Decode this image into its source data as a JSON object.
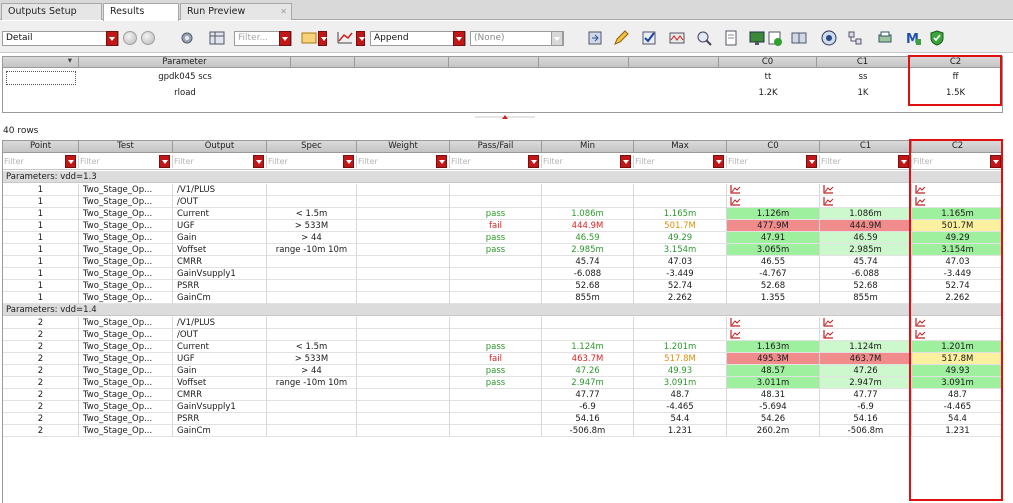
{
  "tabs": [
    {
      "label": "Outputs Setup",
      "active": false
    },
    {
      "label": "Results",
      "active": true
    },
    {
      "label": "Run Preview",
      "active": false,
      "closable": true
    }
  ],
  "toolbar": {
    "view_select": "Detail",
    "filter_placeholder": "Filter...",
    "append_select": "Append",
    "none_select": "(None)"
  },
  "param_table": {
    "headers": [
      "",
      "Parameter",
      "",
      "",
      "",
      "",
      "",
      "C0",
      "C1",
      "C2"
    ],
    "rows": [
      {
        "name": "gpdk045 scs",
        "c0": "tt",
        "c1": "ss",
        "c2": "ff"
      },
      {
        "name": "rload",
        "c0": "1.2K",
        "c1": "1K",
        "c2": "1.5K"
      }
    ]
  },
  "row_count": "40 rows",
  "results": {
    "headers": [
      "Point",
      "Test",
      "Output",
      "Spec",
      "Weight",
      "Pass/Fail",
      "Min",
      "Max",
      "C0",
      "C1",
      "C2"
    ],
    "filter_placeholder": "Filter",
    "groups": [
      {
        "title": "Parameters: vdd=1.3",
        "rows": [
          {
            "point": "1",
            "test": "Two_Stage_Op...",
            "output": "/V1/PLUS",
            "spec": "",
            "pf": "",
            "min": "",
            "max": "",
            "c0": "",
            "c1": "",
            "c2": "",
            "plot": true
          },
          {
            "point": "1",
            "test": "Two_Stage_Op...",
            "output": "/OUT",
            "spec": "",
            "pf": "",
            "min": "",
            "max": "",
            "c0": "",
            "c1": "",
            "c2": "",
            "plot": true
          },
          {
            "point": "1",
            "test": "Two_Stage_Op...",
            "output": "Current",
            "spec": "< 1.5m",
            "pf": "pass",
            "min": "1.086m",
            "max": "1.165m",
            "c0": "1.126m",
            "c1": "1.086m",
            "c2": "1.165m"
          },
          {
            "point": "1",
            "test": "Two_Stage_Op...",
            "output": "UGF",
            "spec": "> 533M",
            "pf": "fail",
            "min": "444.9M",
            "max": "501.7M",
            "c0": "477.9M",
            "c1": "444.9M",
            "c2": "501.7M"
          },
          {
            "point": "1",
            "test": "Two_Stage_Op...",
            "output": "Gain",
            "spec": "> 44",
            "pf": "pass",
            "min": "46.59",
            "max": "49.29",
            "c0": "47.91",
            "c1": "46.59",
            "c2": "49.29"
          },
          {
            "point": "1",
            "test": "Two_Stage_Op...",
            "output": "Voffset",
            "spec": "range -10m 10m",
            "pf": "pass",
            "min": "2.985m",
            "max": "3.154m",
            "c0": "3.065m",
            "c1": "2.985m",
            "c2": "3.154m"
          },
          {
            "point": "1",
            "test": "Two_Stage_Op...",
            "output": "CMRR",
            "spec": "",
            "pf": "",
            "min": "45.74",
            "max": "47.03",
            "c0": "46.55",
            "c1": "45.74",
            "c2": "47.03"
          },
          {
            "point": "1",
            "test": "Two_Stage_Op...",
            "output": "GainVsupply1",
            "spec": "",
            "pf": "",
            "min": "-6.088",
            "max": "-3.449",
            "c0": "-4.767",
            "c1": "-6.088",
            "c2": "-3.449"
          },
          {
            "point": "1",
            "test": "Two_Stage_Op...",
            "output": "PSRR",
            "spec": "",
            "pf": "",
            "min": "52.68",
            "max": "52.74",
            "c0": "52.68",
            "c1": "52.68",
            "c2": "52.74"
          },
          {
            "point": "1",
            "test": "Two_Stage_Op...",
            "output": "GainCm",
            "spec": "",
            "pf": "",
            "min": "855m",
            "max": "2.262",
            "c0": "1.355",
            "c1": "855m",
            "c2": "2.262"
          }
        ]
      },
      {
        "title": "Parameters: vdd=1.4",
        "rows": [
          {
            "point": "2",
            "test": "Two_Stage_Op...",
            "output": "/V1/PLUS",
            "spec": "",
            "pf": "",
            "min": "",
            "max": "",
            "c0": "",
            "c1": "",
            "c2": "",
            "plot": true
          },
          {
            "point": "2",
            "test": "Two_Stage_Op...",
            "output": "/OUT",
            "spec": "",
            "pf": "",
            "min": "",
            "max": "",
            "c0": "",
            "c1": "",
            "c2": "",
            "plot": true
          },
          {
            "point": "2",
            "test": "Two_Stage_Op...",
            "output": "Current",
            "spec": "< 1.5m",
            "pf": "pass",
            "min": "1.124m",
            "max": "1.201m",
            "c0": "1.163m",
            "c1": "1.124m",
            "c2": "1.201m"
          },
          {
            "point": "2",
            "test": "Two_Stage_Op...",
            "output": "UGF",
            "spec": "> 533M",
            "pf": "fail",
            "min": "463.7M",
            "max": "517.8M",
            "c0": "495.3M",
            "c1": "463.7M",
            "c2": "517.8M"
          },
          {
            "point": "2",
            "test": "Two_Stage_Op...",
            "output": "Gain",
            "spec": "> 44",
            "pf": "pass",
            "min": "47.26",
            "max": "49.93",
            "c0": "48.57",
            "c1": "47.26",
            "c2": "49.93"
          },
          {
            "point": "2",
            "test": "Two_Stage_Op...",
            "output": "Voffset",
            "spec": "range -10m 10m",
            "pf": "pass",
            "min": "2.947m",
            "max": "3.091m",
            "c0": "3.011m",
            "c1": "2.947m",
            "c2": "3.091m"
          },
          {
            "point": "2",
            "test": "Two_Stage_Op...",
            "output": "CMRR",
            "spec": "",
            "pf": "",
            "min": "47.77",
            "max": "48.7",
            "c0": "48.31",
            "c1": "47.77",
            "c2": "48.7"
          },
          {
            "point": "2",
            "test": "Two_Stage_Op...",
            "output": "GainVsupply1",
            "spec": "",
            "pf": "",
            "min": "-6.9",
            "max": "-4.465",
            "c0": "-5.694",
            "c1": "-6.9",
            "c2": "-4.465"
          },
          {
            "point": "2",
            "test": "Two_Stage_Op...",
            "output": "PSRR",
            "spec": "",
            "pf": "",
            "min": "54.16",
            "max": "54.4",
            "c0": "54.26",
            "c1": "54.16",
            "c2": "54.4"
          },
          {
            "point": "2",
            "test": "Two_Stage_Op...",
            "output": "GainCm",
            "spec": "",
            "pf": "",
            "min": "-506.8m",
            "max": "1.231",
            "c0": "260.2m",
            "c1": "-506.8m",
            "c2": "1.231"
          }
        ]
      }
    ]
  },
  "colors": {
    "pass_text": "#2c9a2c",
    "fail_text": "#e02020",
    "warn_text": "#e0900a",
    "pass_bg": "#9ef09e",
    "pass_bg_light": "#cdf7cd",
    "fail_bg": "#f08c8c",
    "warn_bg": "#faf0a0",
    "dropdown_red": "#c01818",
    "highlight_border": "#e01010"
  }
}
